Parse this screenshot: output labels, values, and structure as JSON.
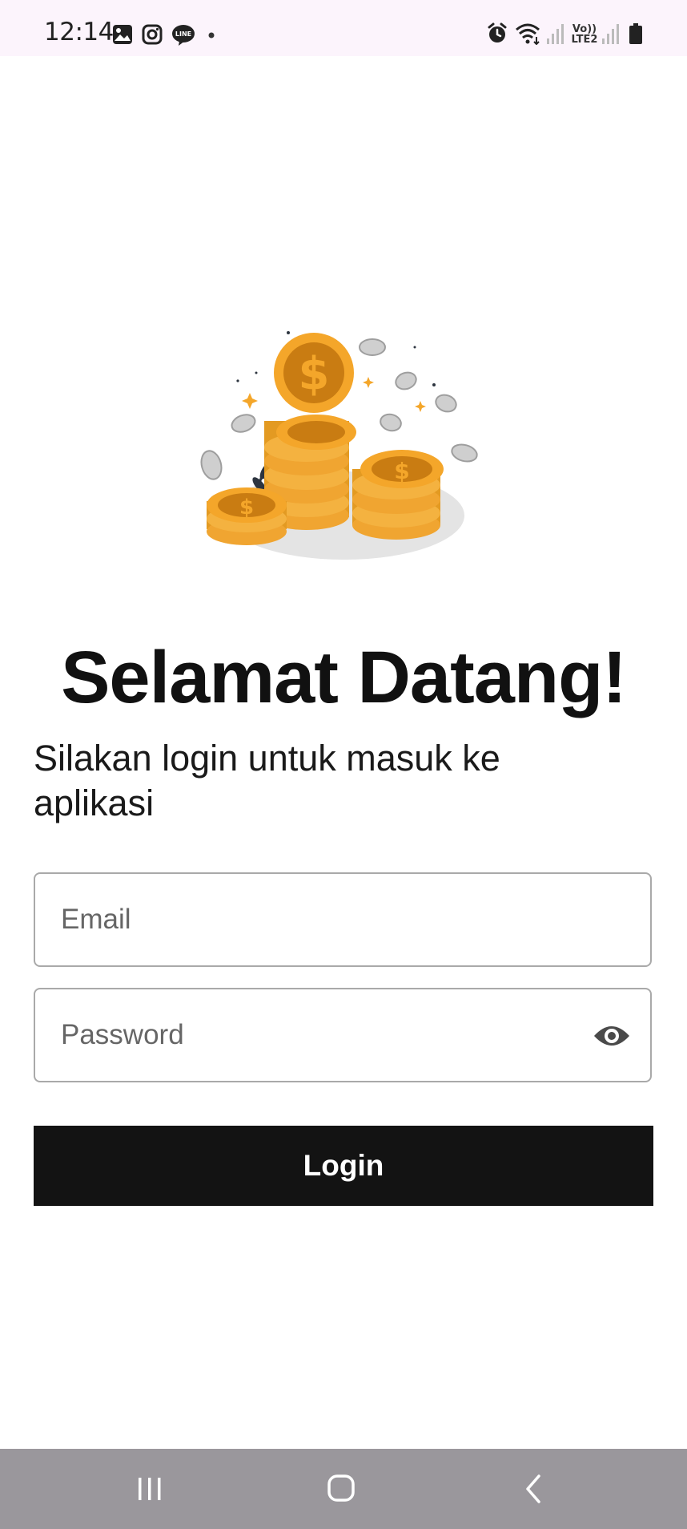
{
  "status_bar": {
    "time": "12:14",
    "left_icons": [
      "gallery-icon",
      "instagram-icon",
      "line-app-icon",
      "notification-dot-icon"
    ],
    "right_icons": [
      "alarm-icon",
      "wifi-icon",
      "signal-icon",
      "volte-icon",
      "signal-icon",
      "battery-icon"
    ],
    "volte_label_top": "Vo))",
    "volte_label_bottom": "LTE2"
  },
  "hero": {
    "icon": "coins-stack-illustration",
    "colors": {
      "gold": "#f4a62a",
      "gold_dark": "#c97c12",
      "silver": "#bdbdbd",
      "shadow": "#e4e4e4"
    }
  },
  "login": {
    "title": "Selamat Datang!",
    "subtitle": "Silakan login untuk masuk ke aplikasi",
    "email_placeholder": "Email",
    "email_value": "",
    "password_placeholder": "Password",
    "password_value": "",
    "password_toggle_icon": "eye-icon",
    "login_label": "Login"
  },
  "nav_bar": {
    "buttons": [
      "recents-icon",
      "home-icon",
      "back-icon"
    ]
  },
  "colors": {
    "status_bar_bg": "#fcf4fc",
    "button_bg": "#131313",
    "button_text": "#ffffff",
    "nav_bar_bg": "#9a979c",
    "input_border": "#a9a9a9"
  }
}
